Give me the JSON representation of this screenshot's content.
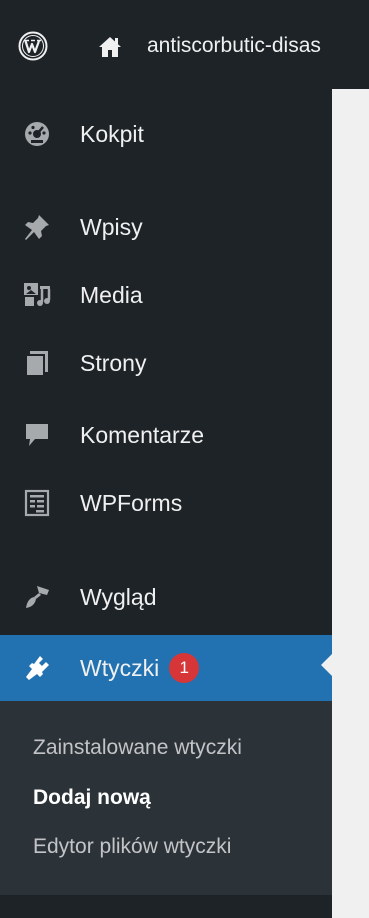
{
  "adminbar": {
    "site_name": "antiscorbutic-disas"
  },
  "menu": {
    "items": [
      {
        "label": "Kokpit"
      },
      {
        "label": "Wpisy"
      },
      {
        "label": "Media"
      },
      {
        "label": "Strony"
      },
      {
        "label": "Komentarze"
      },
      {
        "label": "WPForms"
      },
      {
        "label": "Wygląd"
      },
      {
        "label": "Wtyczki",
        "badge": "1"
      }
    ],
    "submenu": [
      {
        "label": "Zainstalowane wtyczki"
      },
      {
        "label": "Dodaj nową"
      },
      {
        "label": "Edytor plików wtyczki"
      }
    ]
  },
  "colors": {
    "sidebar_bg": "#1d2327",
    "active_bg": "#2271b1",
    "submenu_bg": "#2c3338",
    "badge_bg": "#d63638",
    "content_bg": "#f0f0f1"
  }
}
